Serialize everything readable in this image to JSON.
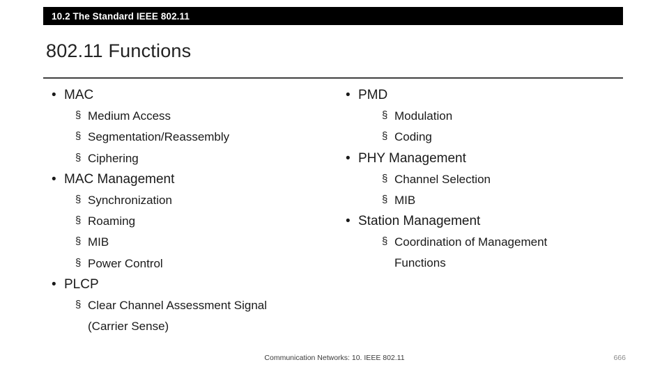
{
  "header": {
    "section_label": "10.2 The Standard IEEE 802.11"
  },
  "title": "802.11 Functions",
  "columns": {
    "left": [
      {
        "label": "MAC",
        "sub": [
          "Medium Access",
          "Segmentation/Reassembly",
          "Ciphering"
        ]
      },
      {
        "label": "MAC Management",
        "sub": [
          "Synchronization",
          "Roaming",
          "MIB",
          "Power Control"
        ]
      },
      {
        "label": "PLCP",
        "sub": [
          "Clear Channel Assessment Signal",
          "(Carrier Sense)"
        ]
      }
    ],
    "right": [
      {
        "label": "PMD",
        "sub": [
          "Modulation",
          "Coding"
        ]
      },
      {
        "label": "PHY Management",
        "sub": [
          "Channel Selection",
          "MIB"
        ]
      },
      {
        "label": "Station Management",
        "sub": [
          "Coordination of Management",
          "Functions"
        ]
      }
    ]
  },
  "footer": {
    "center": "Communication Networks: 10. IEEE 802.11",
    "page": "666"
  },
  "glyphs": {
    "round_bullet": "•",
    "square_bullet": "§"
  }
}
